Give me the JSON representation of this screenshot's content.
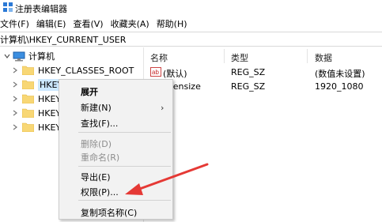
{
  "window": {
    "title": "注册表编辑器"
  },
  "menubar": {
    "items": [
      "文件(F)",
      "编辑(E)",
      "查看(V)",
      "收藏夹(A)",
      "帮助(H)"
    ]
  },
  "address": {
    "path": "计算机\\HKEY_CURRENT_USER"
  },
  "tree": {
    "root_label": "计算机",
    "items": [
      {
        "label": "HKEY_CLASSES_ROOT"
      },
      {
        "label": "HKEY_CURRENT_USER"
      },
      {
        "label": "HKEY_"
      },
      {
        "label": "HKEY_"
      },
      {
        "label": "HKEY_"
      }
    ]
  },
  "list": {
    "columns": [
      "名称",
      "类型",
      "数据"
    ],
    "rows": [
      {
        "name": "(默认)",
        "type": "REG_SZ",
        "data": "(数值未设置)"
      },
      {
        "name": "eensize",
        "type": "REG_SZ",
        "data": "1920_1080"
      }
    ]
  },
  "context_menu": {
    "items": [
      {
        "label": "展开",
        "bold": true
      },
      {
        "label": "新建(N)",
        "submenu": true
      },
      {
        "label": "查找(F)..."
      },
      {
        "label": "删除(D)",
        "disabled": true
      },
      {
        "label": "重命名(R)",
        "disabled": true
      },
      {
        "label": "导出(E)"
      },
      {
        "label": "权限(P)..."
      },
      {
        "label": "复制项名称(C)"
      }
    ]
  },
  "colors": {
    "selection": "#cce8ff",
    "folder": "#f8d775",
    "annotation_arrow": "#e53935",
    "menu_bg": "#f2f2f2"
  },
  "icons": {
    "app": "regedit-icon",
    "computer": "computer-icon",
    "folder": "folder-icon",
    "string_value": "ab-value-icon",
    "chevron": "chevron-right-icon"
  }
}
